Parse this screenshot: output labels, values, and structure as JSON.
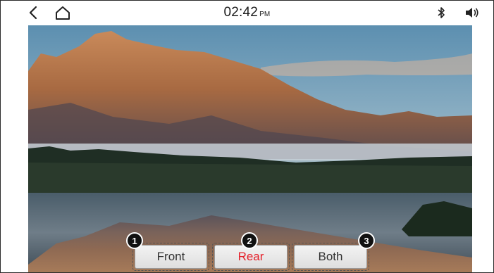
{
  "status_bar": {
    "time": "02:42",
    "ampm": "PM"
  },
  "icons": {
    "back": "back-icon",
    "home": "home-icon",
    "bluetooth": "bluetooth-icon",
    "volume": "volume-icon"
  },
  "options": [
    {
      "number": "1",
      "label": "Front",
      "selected": false
    },
    {
      "number": "2",
      "label": "Rear",
      "selected": true
    },
    {
      "number": "3",
      "label": "Both",
      "selected": false
    }
  ],
  "colors": {
    "selected_text": "#e5202a",
    "default_text": "#333333"
  }
}
